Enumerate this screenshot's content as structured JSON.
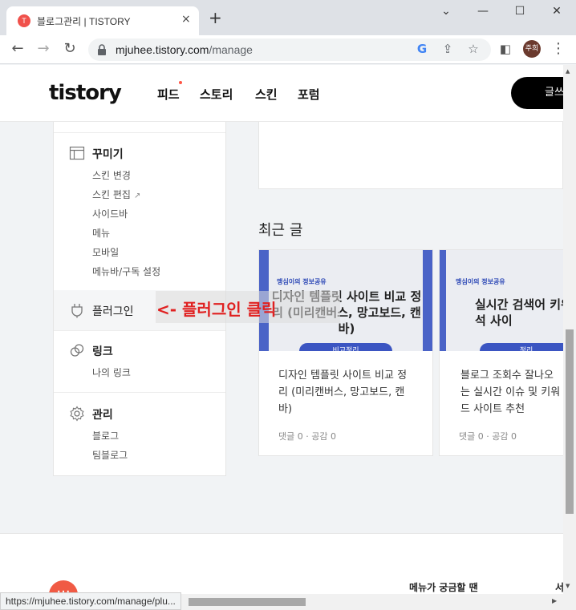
{
  "browser": {
    "tab_title": "블로그관리 | TISTORY",
    "tab_close": "×",
    "new_tab": "+",
    "win_minimize": "⌄",
    "win_restore": "—",
    "win_maximize": "☐",
    "win_close": "✕",
    "url_host": "mjuhee.tistory.com",
    "url_path": "/manage",
    "profile_label": "주희",
    "status_url": "https://mjuhee.tistory.com/manage/plu..."
  },
  "header": {
    "logo": "tistory",
    "nav": [
      "피드",
      "스토리",
      "스킨",
      "포럼"
    ],
    "write_button": "글쓰"
  },
  "sidebar": {
    "decorate": {
      "title": "꾸미기",
      "items": [
        "스킨 변경",
        "스킨 편집",
        "사이드바",
        "메뉴",
        "모바일",
        "메뉴바/구독 설정"
      ]
    },
    "plugin": {
      "title": "플러그인"
    },
    "link": {
      "title": "링크",
      "items": [
        "나의 링크"
      ]
    },
    "manage": {
      "title": "관리",
      "items": [
        "블로그",
        "팀블로그"
      ]
    }
  },
  "annotation": "<- 플러그인 클릭",
  "recent": {
    "title": "최근 글",
    "posts": [
      {
        "thumb_brand": "맹심이의 정보공유",
        "thumb_headline": "디자인 템플릿 사이트 비교 정리 (미리캔버스, 망고보드, 캔바)",
        "thumb_pill": "비교정리",
        "title": "디자인 템플릿 사이트 비교 정리 (미리캔버스, 망고보드, 캔바)",
        "meta": "댓글 0 · 공감 0"
      },
      {
        "thumb_brand": "맹심이의 정보공유",
        "thumb_headline": "실시간 검색어 키워드 분석 사이",
        "thumb_pill": "정리",
        "title": "블로그 조회수 잘나오는 실시간 이슈 및 키워드 사이트 추천",
        "meta": "댓글 0 · 공감 0"
      }
    ]
  },
  "footer": {
    "help_text": "메뉴가 궁금할 땐",
    "help_text_cut": "서",
    "fab_label": "···"
  },
  "colors": {
    "accent": "#f05a44",
    "annotation": "#e02020",
    "thumb_blue": "#3b55c2"
  }
}
